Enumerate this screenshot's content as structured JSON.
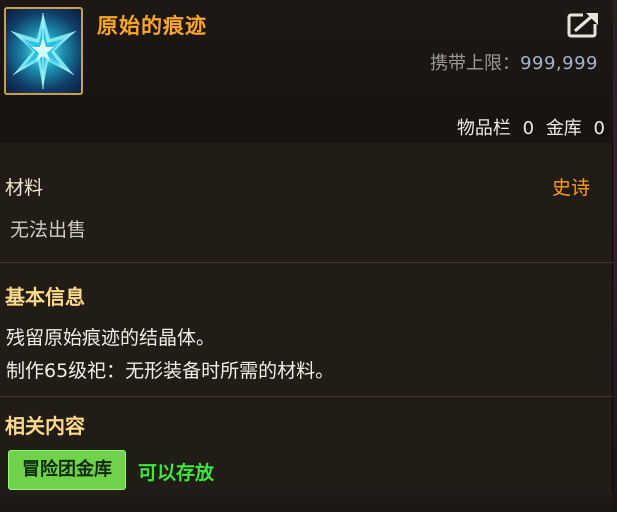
{
  "item": {
    "name": "原始的痕迹",
    "icon": "crystal-shard-icon",
    "carry_limit_label": "携带上限：",
    "carry_limit_value": "999,999",
    "inventory_label": "物品栏",
    "inventory_count": "0",
    "storage_label": "金库",
    "storage_count": "0"
  },
  "details": {
    "type": "材料",
    "rarity": "史诗",
    "sell_status": "无法出售"
  },
  "basic_info": {
    "title": "基本信息",
    "lines": [
      "残留原始痕迹的结晶体。",
      "制作65级祀：无形装备时所需的材料。"
    ]
  },
  "related": {
    "title": "相关内容",
    "tag_label": "冒险团金库",
    "tag_status": "可以存放"
  },
  "colors": {
    "name": "#ffa52a",
    "rarity": "#ff9a1a",
    "section_title": "#ffd98a",
    "tag_bg": "#6fd24a",
    "tag_status": "#3ee83e"
  }
}
